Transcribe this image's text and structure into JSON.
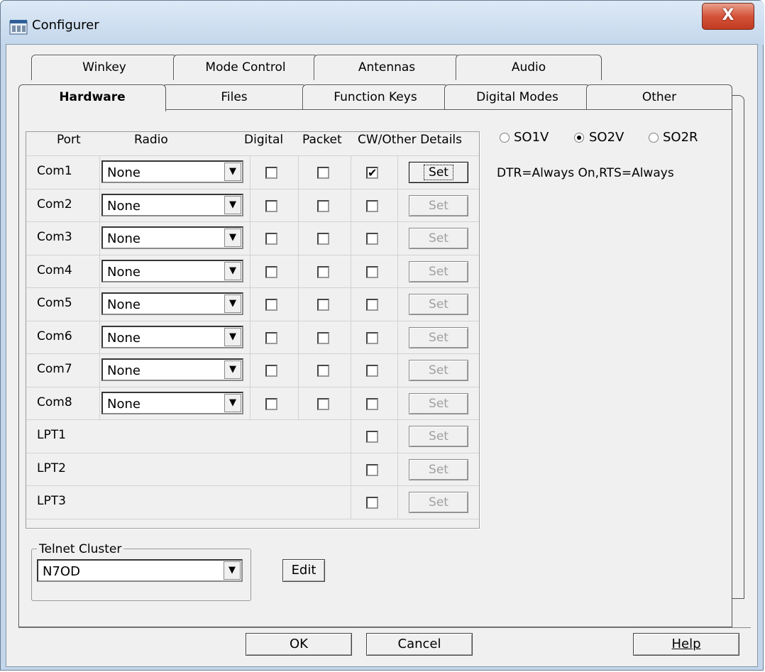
{
  "window": {
    "title": "Configurer",
    "close_label": "X"
  },
  "tabs": {
    "back_row": [
      "Winkey",
      "Mode Control",
      "Antennas",
      "Audio"
    ],
    "front_row": [
      "Hardware",
      "Files",
      "Function Keys",
      "Digital Modes",
      "Other"
    ],
    "active": "Hardware"
  },
  "columns": {
    "port": "Port",
    "radio": "Radio",
    "digital": "Digital",
    "packet": "Packet",
    "cw": "CW/Other Details"
  },
  "so_options": {
    "so1v": "SO1V",
    "so2v": "SO2V",
    "so2r": "SO2R",
    "selected": "SO2V"
  },
  "details_text": "DTR=Always On,RTS=Always",
  "rows": [
    {
      "port": "Com1",
      "radio": "None",
      "digital": false,
      "packet": false,
      "cw": true,
      "set_label": "Set",
      "set_enabled": true
    },
    {
      "port": "Com2",
      "radio": "None",
      "digital": false,
      "packet": false,
      "cw": false,
      "set_label": "Set",
      "set_enabled": false
    },
    {
      "port": "Com3",
      "radio": "None",
      "digital": false,
      "packet": false,
      "cw": false,
      "set_label": "Set",
      "set_enabled": false
    },
    {
      "port": "Com4",
      "radio": "None",
      "digital": false,
      "packet": false,
      "cw": false,
      "set_label": "Set",
      "set_enabled": false
    },
    {
      "port": "Com5",
      "radio": "None",
      "digital": false,
      "packet": false,
      "cw": false,
      "set_label": "Set",
      "set_enabled": false
    },
    {
      "port": "Com6",
      "radio": "None",
      "digital": false,
      "packet": false,
      "cw": false,
      "set_label": "Set",
      "set_enabled": false
    },
    {
      "port": "Com7",
      "radio": "None",
      "digital": false,
      "packet": false,
      "cw": false,
      "set_label": "Set",
      "set_enabled": false
    },
    {
      "port": "Com8",
      "radio": "None",
      "digital": false,
      "packet": false,
      "cw": false,
      "set_label": "Set",
      "set_enabled": false
    },
    {
      "port": "LPT1",
      "radio": null,
      "cw": false,
      "set_label": "Set",
      "set_enabled": false
    },
    {
      "port": "LPT2",
      "radio": null,
      "cw": false,
      "set_label": "Set",
      "set_enabled": false
    },
    {
      "port": "LPT3",
      "radio": null,
      "cw": false,
      "set_label": "Set",
      "set_enabled": false
    }
  ],
  "telnet": {
    "group_title": "Telnet Cluster",
    "value": "N7OD",
    "edit_label": "Edit"
  },
  "footer": {
    "ok": "OK",
    "cancel": "Cancel",
    "help": "Help"
  },
  "icons": {
    "app": "configurer-icon",
    "dropdown": "chevron-down-icon",
    "check": "check-icon"
  }
}
